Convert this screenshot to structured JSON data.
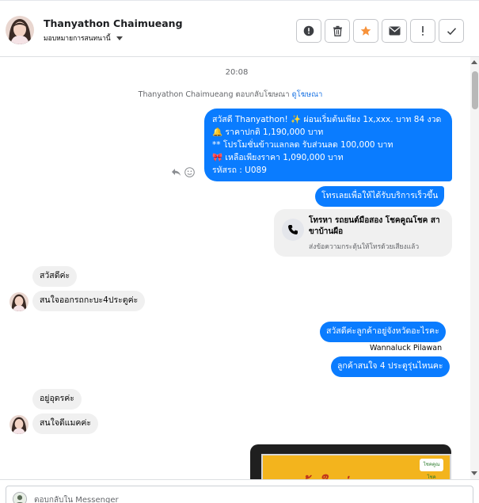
{
  "header": {
    "name": "Thanyathon Chaimueang",
    "subtitle": "มอบหมายการสนทนานี้",
    "actions": [
      {
        "icon": "alert-circle-icon",
        "name": "alert-button"
      },
      {
        "icon": "trash-icon",
        "name": "delete-button"
      },
      {
        "icon": "star-icon",
        "name": "star-button"
      },
      {
        "icon": "envelope-icon",
        "name": "mark-unread-button"
      },
      {
        "icon": "exclamation-icon",
        "name": "spam-button"
      },
      {
        "icon": "check-icon",
        "name": "done-button"
      }
    ],
    "star_color": "#f7923a"
  },
  "conversation": {
    "time": "20:08",
    "reply_info": {
      "text": "Thanyathon Chaimueang ตอบกลับโฆษณา",
      "link": "ดูโฆษณา"
    },
    "promo_lines": [
      "สวัสดี Thanyathon! ✨ ผ่อนเริ่มต้นเพียง 1x,xxx. บาท 84 งวด",
      "🔔 ราคาปกติ 1,190,000 บาท",
      "** โปรโมชั่นข้าวแลกลด รับส่วนลด 100,000 บาท",
      "🎀 เหลือเพียงราคา 1,090,000 บาท",
      " รหัสรถ : U089"
    ],
    "call_now_label": "โทรเลยเพื่อให้ได้รับบริการเร็วขึ้น",
    "call_card": {
      "title": "โทรหา รถยนต์มือสอง โชคคูณโชค สาขาบ้านผือ",
      "subtitle": "ส่งข้อความกระตุ้นให้โทรด้วยเสียงแล้ว"
    },
    "incoming_1": [
      "สวัสดีค่ะ",
      "สนใจออกรถกะบะ4ประตูค่ะ"
    ],
    "outgoing_1": "สวัสดีค่ะลูกค้าอยู่จังหวัดอะไรคะ",
    "agent_name": "Wannaluck Pilawan",
    "outgoing_2": "ลูกค้าสนใจ 4 ประตูรุ่นไหนคะ",
    "incoming_2": [
      "อยู่อุดรค่ะ",
      "สนใจดีแมคค่ะ"
    ],
    "image_caption": "รถเข้าใหม่",
    "image_logo": "โชคคูณโชค"
  },
  "composer": {
    "placeholder": "ตอบกลับใน Messenger"
  },
  "colors": {
    "outgoing_bubble": "#0a7cff",
    "incoming_bubble": "#f0f0f0",
    "link": "#1b74e4"
  }
}
